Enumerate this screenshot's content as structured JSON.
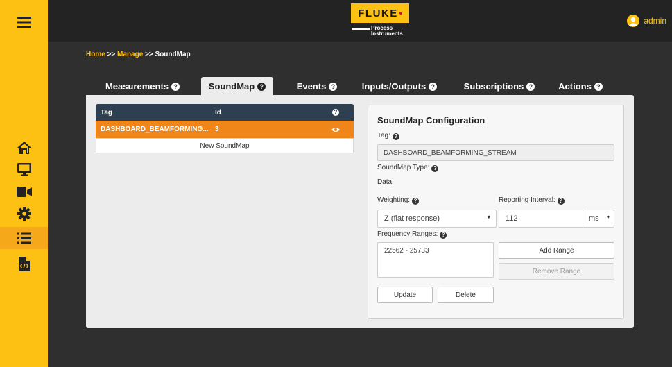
{
  "brand": {
    "logo_text": "FLUKE",
    "logo_sub_line1": "Process",
    "logo_sub_line2": "Instruments",
    "primary_color": "#fdc113",
    "accent_orange": "#f08519",
    "header_dark": "#2e3f51"
  },
  "user": {
    "name": "admin"
  },
  "sidebar": {
    "items": [
      {
        "icon": "home-icon"
      },
      {
        "icon": "monitor-icon"
      },
      {
        "icon": "video-camera-icon"
      },
      {
        "icon": "gear-icon"
      },
      {
        "icon": "list-icon",
        "active": true
      },
      {
        "icon": "code-file-icon"
      }
    ]
  },
  "breadcrumb": {
    "home": "Home",
    "sep1": ">>",
    "manage": "Manage",
    "sep2": ">>",
    "current": "SoundMap"
  },
  "tabs": [
    {
      "label": "Measurements",
      "help": "?"
    },
    {
      "label": "SoundMap",
      "help": "?",
      "active": true
    },
    {
      "label": "Events",
      "help": "?"
    },
    {
      "label": "Inputs/Outputs",
      "help": "?"
    },
    {
      "label": "Subscriptions",
      "help": "?"
    },
    {
      "label": "Actions",
      "help": "?"
    }
  ],
  "table": {
    "columns": [
      "Tag",
      "Id"
    ],
    "help": "?",
    "rows": [
      {
        "tag": "DASHBOARD_BEAMFORMING...",
        "id": "3",
        "action_icon": "eye-icon"
      }
    ],
    "new_label": "New SoundMap"
  },
  "config": {
    "title": "SoundMap Configuration",
    "tag_label": "Tag:",
    "tag_value": "DASHBOARD_BEAMFORMING_STREAM",
    "type_label": "SoundMap Type:",
    "type_value": "Data",
    "weighting_label": "Weighting:",
    "weighting_value": "Z (flat response)",
    "interval_label": "Reporting Interval:",
    "interval_value": "112",
    "interval_unit": "ms",
    "freq_label": "Frequency Ranges:",
    "freq_ranges": [
      "22562 - 25733"
    ],
    "add_range": "Add Range",
    "remove_range": "Remove Range",
    "update": "Update",
    "delete": "Delete",
    "help": "?",
    "caret": "♦"
  }
}
